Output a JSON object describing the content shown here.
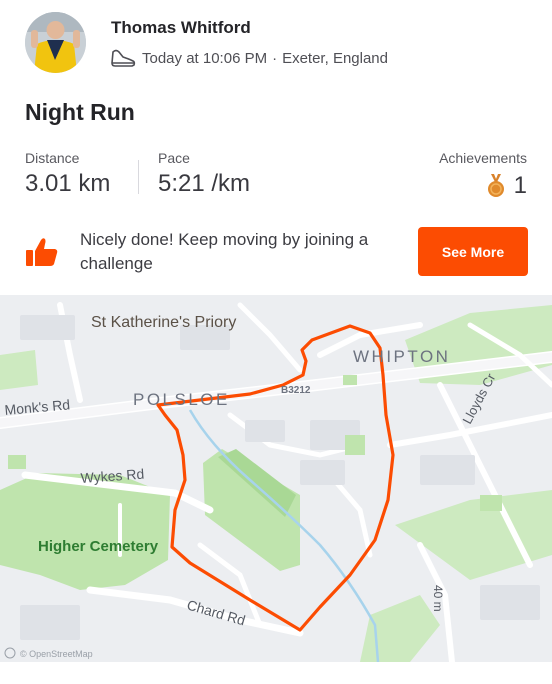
{
  "athlete": {
    "name": "Thomas Whitford",
    "activity_icon": "running-shoe-icon",
    "time": "Today at 10:06 PM",
    "separator": "·",
    "location": "Exeter, England"
  },
  "activity": {
    "title": "Night Run"
  },
  "stats": {
    "distance": {
      "label": "Distance",
      "value": "3.01 km"
    },
    "pace": {
      "label": "Pace",
      "value": "5:21 /km"
    },
    "achievements": {
      "label": "Achievements",
      "value": "1",
      "icon": "medal-icon"
    }
  },
  "challenge": {
    "icon": "thumbs-up-icon",
    "text": "Nicely done! Keep moving by joining a challenge",
    "button_label": "See More"
  },
  "map": {
    "labels": {
      "priory": "St Katherine's Priory",
      "whipton": "WHIPTON",
      "polsloe": "POLSLOE",
      "road_b3212": "B3212",
      "monks_rd": "Monk's Rd",
      "wykes_rd": "Wykes Rd",
      "higher_cemetery": "Higher Cemetery",
      "chard_rd": "Chard Rd",
      "lloyds_cr": "Lloyds Cr",
      "road_40m": "40 m"
    },
    "attribution": "© OpenStreetMap",
    "colors": {
      "route": "#fc4c02",
      "park": "#b7dfa5",
      "road": "#ffffff",
      "base": "#eceef1",
      "water": "#9cd0ea"
    }
  },
  "colors": {
    "accent": "#fc4c02",
    "text": "#242428",
    "muted": "#59595f"
  }
}
